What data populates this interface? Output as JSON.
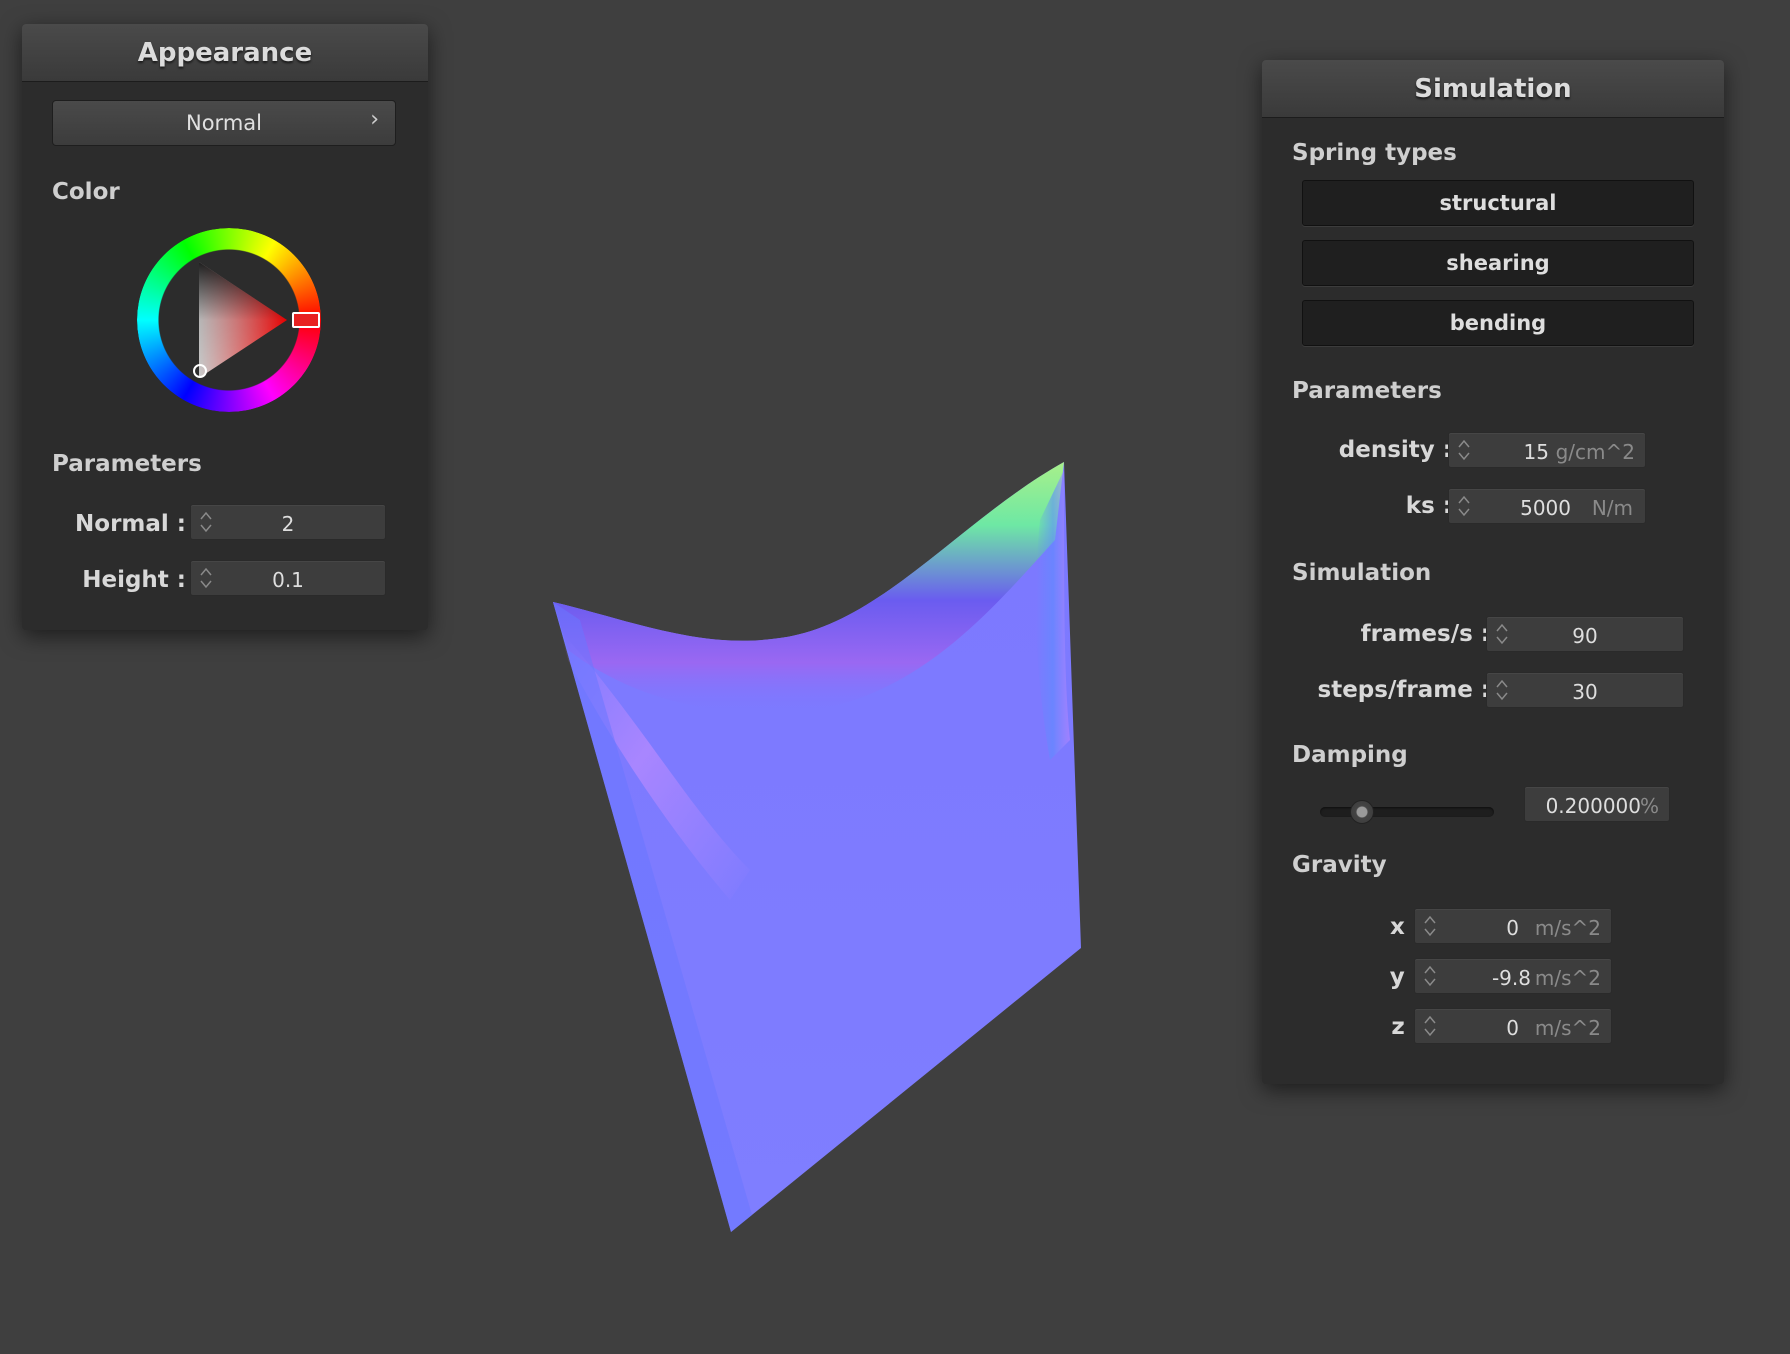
{
  "appearance": {
    "title": "Appearance",
    "mode_button": "Normal",
    "mode_chevron": "›",
    "color_label": "Color",
    "params_label": "Parameters",
    "normal_label": "Normal :",
    "normal_value": "2",
    "height_label": "Height :",
    "height_value": "0.1",
    "selected_color": "#ff0000"
  },
  "simulation": {
    "title": "Simulation",
    "spring_types_label": "Spring types",
    "spring_types": [
      "structural",
      "shearing",
      "bending"
    ],
    "params_label": "Parameters",
    "density_label": "density :",
    "density_value": "15",
    "density_unit": "g/cm^2",
    "ks_label": "ks :",
    "ks_value": "5000",
    "ks_unit": "N/m",
    "sim_label": "Simulation",
    "fps_label": "frames/s :",
    "fps_value": "90",
    "spf_label": "steps/frame :",
    "spf_value": "30",
    "damping_label": "Damping",
    "damping_value": "0.200000",
    "damping_unit": "%",
    "damping_fraction": 0.2,
    "gravity_label": "Gravity",
    "gx_label": "x :",
    "gx_value": "0",
    "gy_label": "y :",
    "gy_value": "-9.8",
    "gz_label": "z :",
    "gz_value": "0",
    "gravity_unit": "m/s^2"
  },
  "icons": {
    "spin_arrows": "updown-arrows-icon",
    "chevron": "chevron-right-icon"
  }
}
